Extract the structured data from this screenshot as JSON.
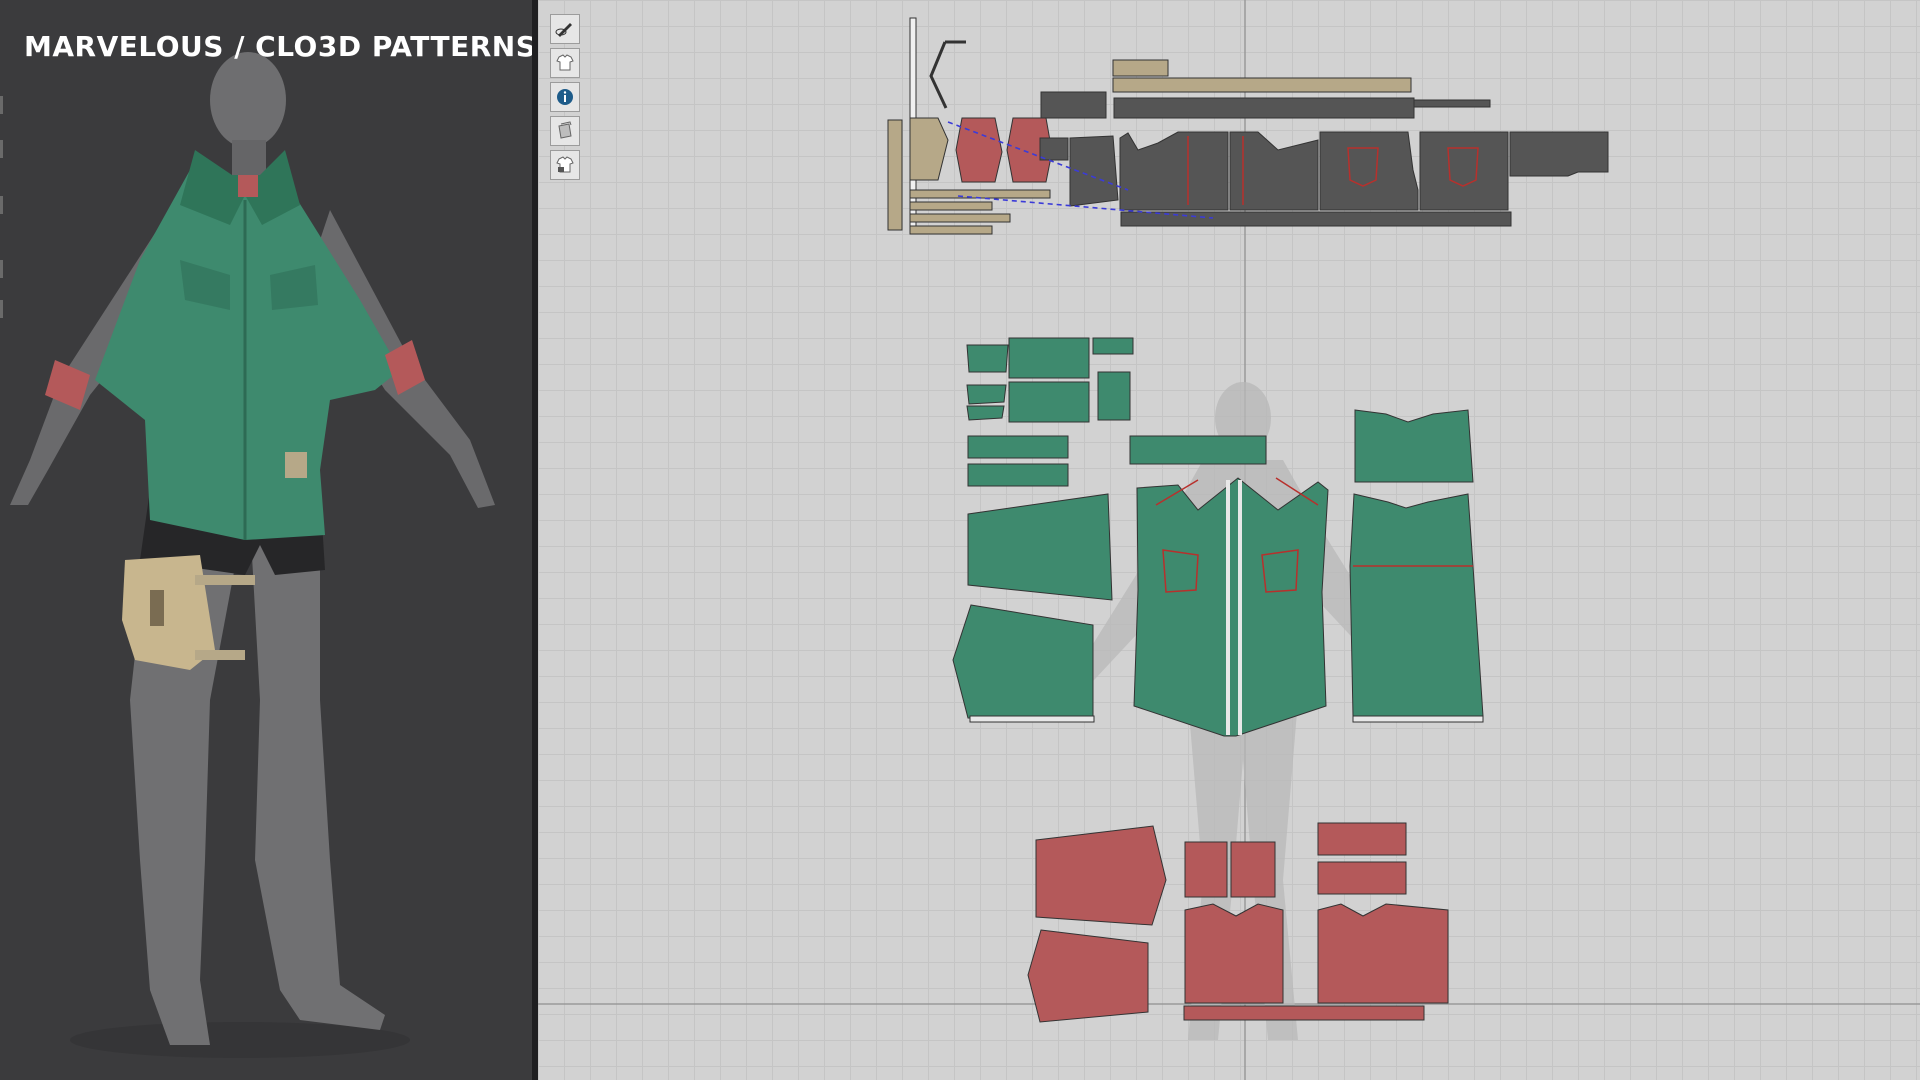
{
  "overlay": {
    "title": "MARVELOUS / CLO3D PATTERNS"
  },
  "toolbar": {
    "tools": [
      {
        "icon": "pen-eye-icon"
      },
      {
        "icon": "garment-eye-icon"
      },
      {
        "icon": "info-icon"
      },
      {
        "icon": "fabric-icon"
      },
      {
        "icon": "garment-lock-icon"
      }
    ]
  },
  "colors": {
    "view3d_bg": "#3b3b3d",
    "pattern_bg": "#d2d2d2",
    "jacket_green": "#3e8a6e",
    "cuff_red": "#b4595a",
    "shorts_gray": "#5a5a5a",
    "strap_tan": "#b6a888",
    "seam_red": "#b8302c",
    "sewing_line_blue": "#3b3bd8"
  }
}
